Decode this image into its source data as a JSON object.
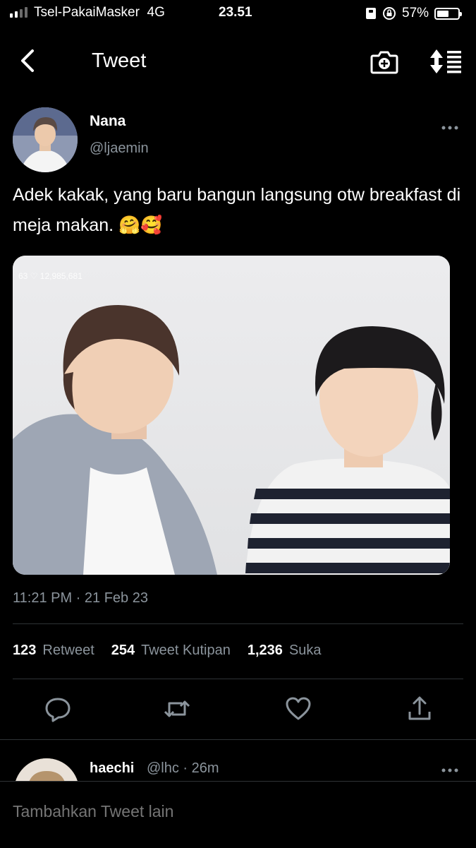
{
  "status_bar": {
    "carrier": "Tsel-PakaiMasker",
    "network": "4G",
    "time": "23.51",
    "battery_percent": "57%",
    "battery_level": 0.57
  },
  "nav": {
    "title": "Tweet",
    "back_icon": "chevron-left-icon",
    "camera_icon": "camera-add-icon",
    "sort_icon": "sort-icon"
  },
  "tweet": {
    "author_name": "Nana",
    "author_handle": "@ljaemin",
    "text": "Adek kakak, yang baru bangun langsung otw breakfast di meja makan. 🤗🥰",
    "photo_overlay": "63  ♡ 12,985,681",
    "timestamp": "11:21 PM · 21 Feb 23",
    "retweets": "123",
    "retweets_label": "Retweet",
    "quotes": "254",
    "quotes_label": "Tweet Kutipan",
    "likes": "1,236",
    "likes_label": "Suka"
  },
  "reply": {
    "name": "haechi",
    "handle_time": "@lhc · 26m"
  },
  "compose": {
    "placeholder": "Tambahkan Tweet lain"
  },
  "colors": {
    "background": "#000000",
    "secondary_text": "#8b949c",
    "divider": "#2f3336"
  }
}
